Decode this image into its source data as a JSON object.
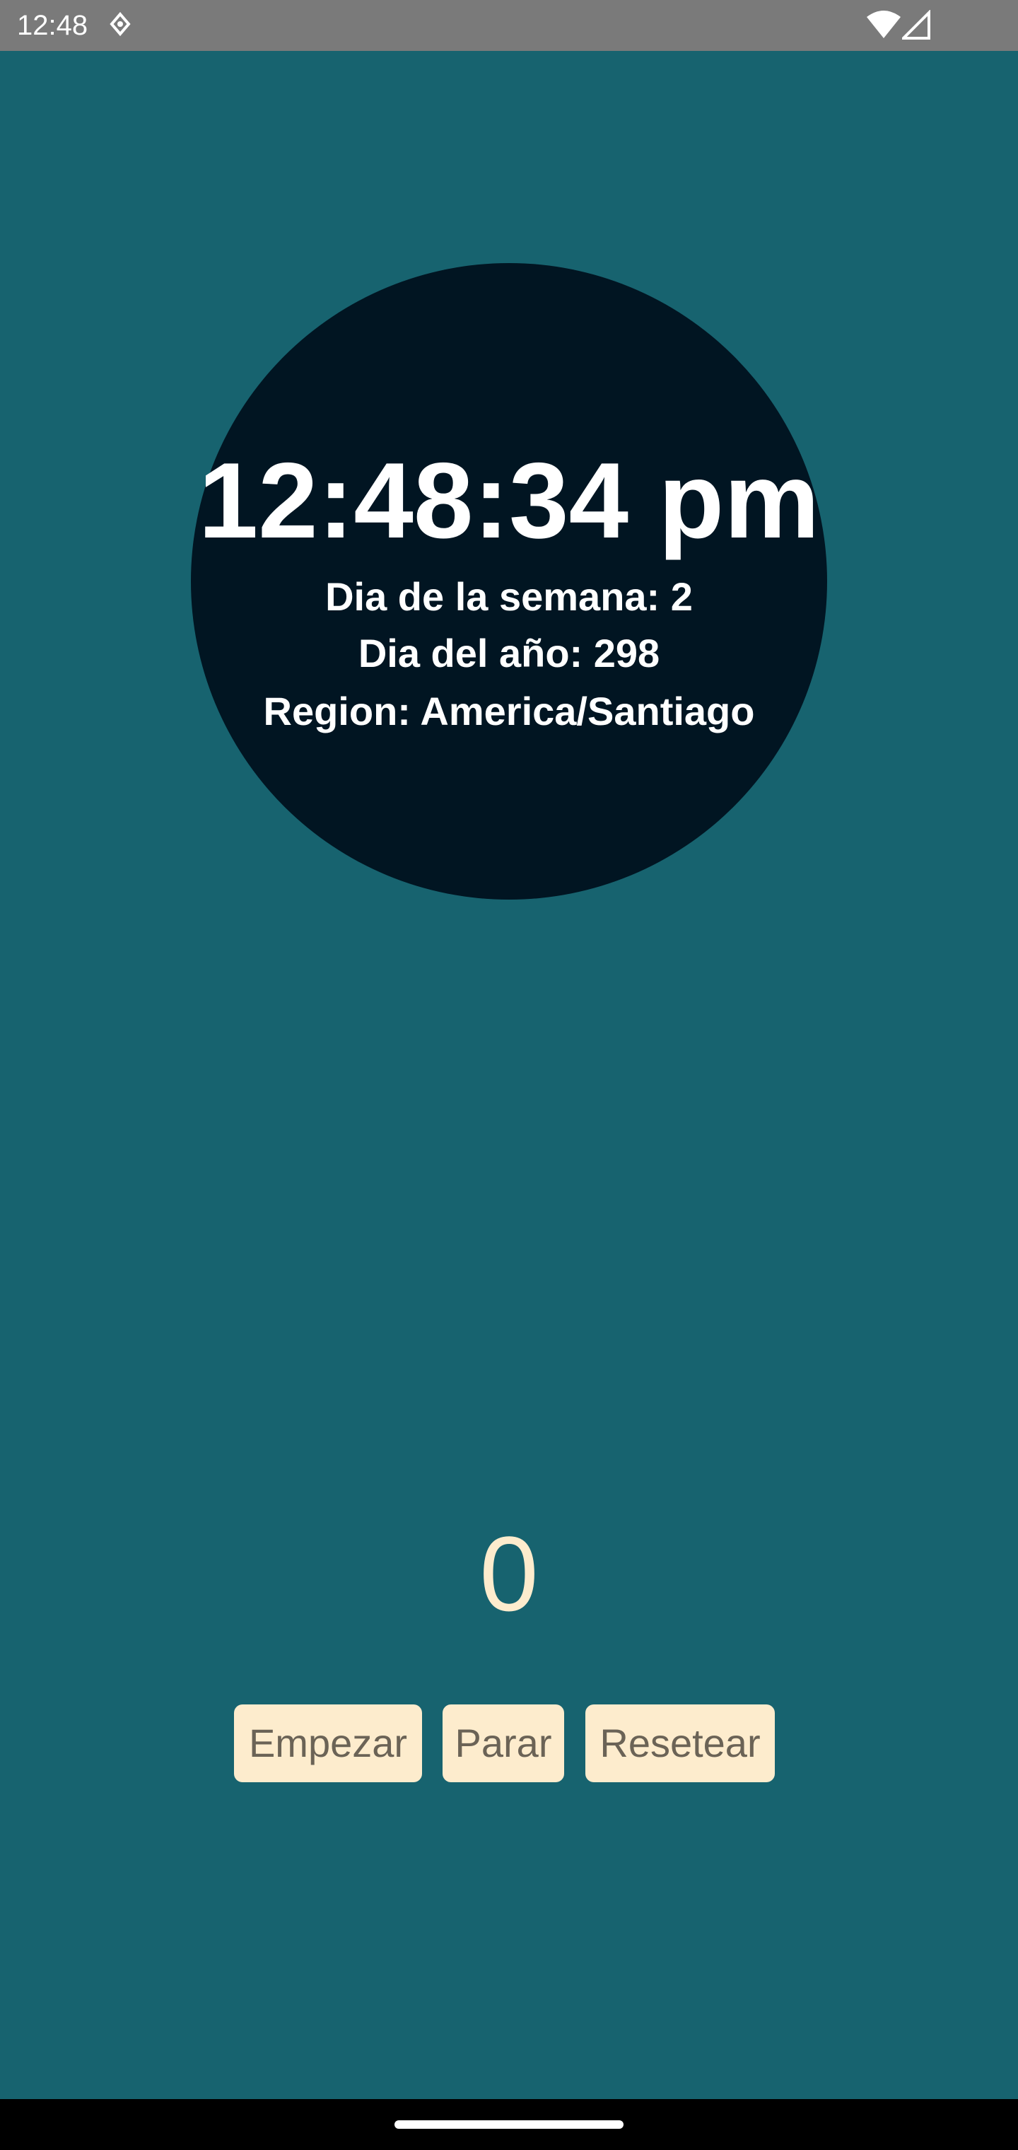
{
  "status_bar": {
    "time": "12:48",
    "icons": [
      "location-diamond-icon",
      "wifi-icon",
      "signal-icon"
    ]
  },
  "colors": {
    "background": "#17636f",
    "circle": "#011522",
    "status_bar": "#7a7a7a",
    "button_bg": "#fdeccd",
    "button_text": "#6b6356",
    "counter_text": "#fdeccd"
  },
  "clock": {
    "time": "12:48:34 pm",
    "day_of_week": "Dia de la semana: 2",
    "day_of_year": "Dia del año: 298",
    "region": "Region: America/Santiago"
  },
  "stopwatch": {
    "value": "0",
    "buttons": {
      "start": "Empezar",
      "stop": "Parar",
      "reset": "Resetear"
    }
  }
}
